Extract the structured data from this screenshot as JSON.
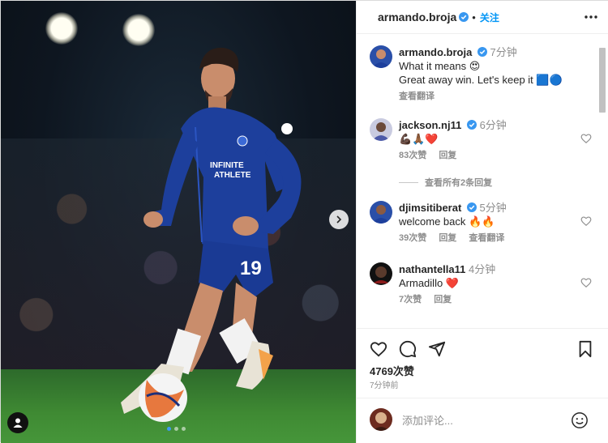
{
  "post": {
    "author": "armando.broja",
    "follow_label": "关注",
    "caption_time": "7分钟",
    "caption_line1": "What it means 😍",
    "caption_line2": "Great away win. Let's keep it 🟦🔵",
    "translate_label": "查看翻译",
    "likes": "4769次赞",
    "posted_ago": "7分钟前",
    "image_dots": 3,
    "active_dot": 1
  },
  "comments": [
    {
      "user": "jackson.nj11",
      "time": "6分钟",
      "text": "💪🏿🙏🏾❤️",
      "likes": "83次赞",
      "reply": "回复"
    },
    {
      "user": "djimsitiberat",
      "time": "5分钟",
      "text": "welcome back 🔥🔥",
      "likes": "39次赞",
      "reply": "回复",
      "translate": "查看翻译"
    },
    {
      "user": "nathantella11",
      "time": "4分钟",
      "text": "Armadillo ❤️",
      "likes": "7次赞",
      "reply": "回复"
    }
  ],
  "view_replies": "查看所有2条回复",
  "add_comment": {
    "placeholder": "添加评论..."
  },
  "icons": {
    "more": "more-horizontal-icon",
    "like": "heart-icon",
    "comment": "comment-icon",
    "share": "send-icon",
    "save": "bookmark-icon",
    "emoji": "emoji-icon",
    "next": "chevron-right-icon",
    "tag": "user-tag-icon"
  },
  "colors": {
    "accent": "#0095f6",
    "verified": "#3897f0",
    "heart": "#ed4956",
    "kit": "#1d3f9c"
  }
}
